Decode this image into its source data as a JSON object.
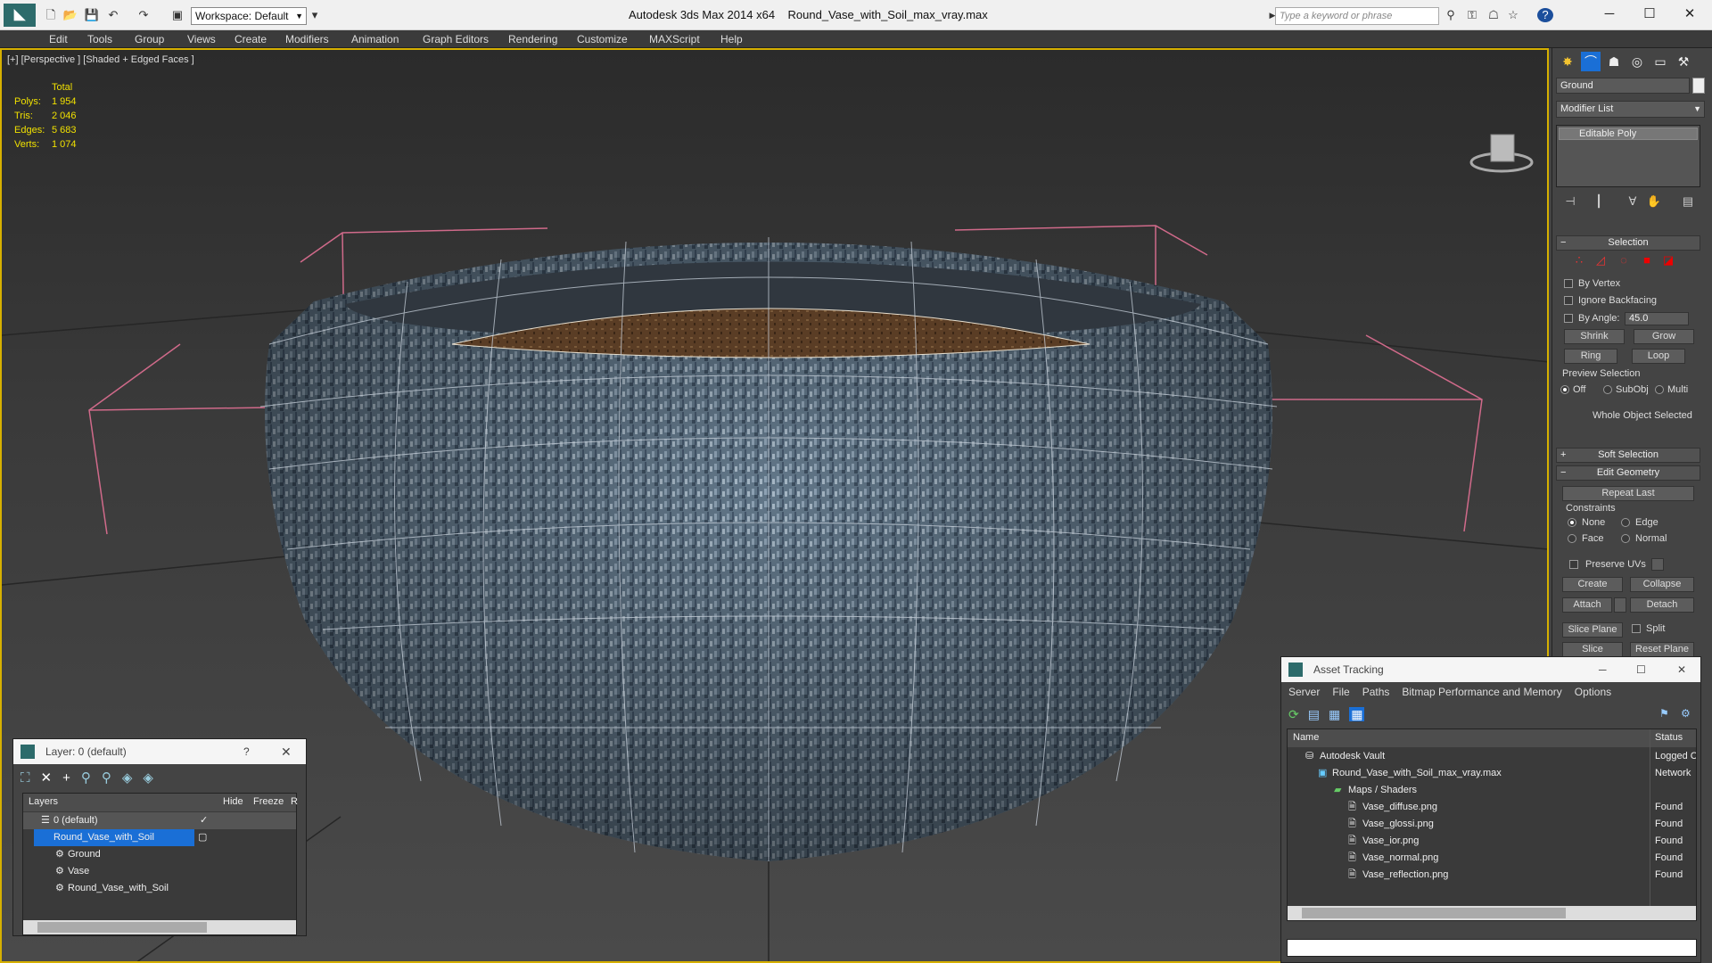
{
  "app": {
    "title": "Autodesk 3ds Max  2014 x64",
    "file": "Round_Vase_with_Soil_max_vray.max",
    "workspace": "Workspace: Default",
    "search_placeholder": "Type a keyword or phrase"
  },
  "menu": [
    "Edit",
    "Tools",
    "Group",
    "Views",
    "Create",
    "Modifiers",
    "Animation",
    "Graph Editors",
    "Rendering",
    "Customize",
    "MAXScript",
    "Help"
  ],
  "viewport": {
    "label": "[+] [Perspective ] [Shaded + Edged Faces ]",
    "stats": {
      "header": "Total",
      "rows": [
        {
          "k": "Polys:",
          "v": "1 954"
        },
        {
          "k": "Tris:",
          "v": "2 046"
        },
        {
          "k": "Edges:",
          "v": "5 683"
        },
        {
          "k": "Verts:",
          "v": "1 074"
        }
      ]
    }
  },
  "command_panel": {
    "object_name": "Ground",
    "modifier_list": "Modifier List",
    "stack_item": "Editable Poly",
    "selection": {
      "title": "Selection",
      "by_vertex": "By Vertex",
      "ignore_backfacing": "Ignore Backfacing",
      "by_angle": "By Angle:",
      "angle_value": "45.0",
      "shrink": "Shrink",
      "grow": "Grow",
      "ring": "Ring",
      "loop": "Loop",
      "preview": "Preview Selection",
      "off": "Off",
      "subobj": "SubObj",
      "multi": "Multi",
      "status": "Whole Object Selected"
    },
    "soft_selection": "Soft Selection",
    "edit_geometry": {
      "title": "Edit Geometry",
      "repeat_last": "Repeat Last",
      "constraints": "Constraints",
      "none": "None",
      "edge": "Edge",
      "face": "Face",
      "normal": "Normal",
      "preserve_uvs": "Preserve UVs",
      "create": "Create",
      "collapse": "Collapse",
      "attach": "Attach",
      "detach": "Detach",
      "slice_plane": "Slice Plane",
      "split": "Split",
      "slice": "Slice",
      "reset_plane": "Reset Plane"
    }
  },
  "layer_panel": {
    "title": "Layer: 0 (default)",
    "help": "?",
    "col_layers": "Layers",
    "col_hide": "Hide",
    "col_freeze": "Freeze",
    "col_r": "R",
    "rows": [
      {
        "name": "0 (default)"
      },
      {
        "name": "Round_Vase_with_Soil"
      },
      {
        "name": "Ground"
      },
      {
        "name": "Vase"
      },
      {
        "name": "Round_Vase_with_Soil"
      }
    ]
  },
  "asset_panel": {
    "title": "Asset Tracking",
    "menu": [
      "Server",
      "File",
      "Paths",
      "Bitmap Performance and Memory",
      "Options"
    ],
    "col_name": "Name",
    "col_status": "Status",
    "rows": [
      {
        "name": "Autodesk Vault",
        "status": "Logged C"
      },
      {
        "name": "Round_Vase_with_Soil_max_vray.max",
        "status": "Network"
      },
      {
        "name": "Maps / Shaders",
        "status": ""
      },
      {
        "name": "Vase_diffuse.png",
        "status": "Found"
      },
      {
        "name": "Vase_glossi.png",
        "status": "Found"
      },
      {
        "name": "Vase_ior.png",
        "status": "Found"
      },
      {
        "name": "Vase_normal.png",
        "status": "Found"
      },
      {
        "name": "Vase_reflection.png",
        "status": "Found"
      }
    ]
  },
  "colors": {
    "accent": "#d6b000",
    "selection": "#1a6fd6",
    "stats": "#f0e000",
    "bbox": "#d06a8a"
  }
}
